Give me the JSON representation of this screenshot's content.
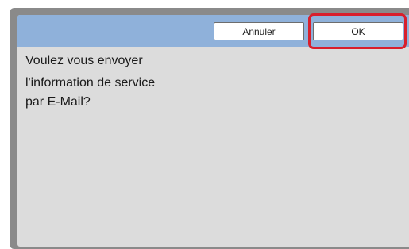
{
  "dialog": {
    "buttons": {
      "cancel_label": "Annuler",
      "ok_label": "OK"
    },
    "message_lines": [
      "Voulez vous envoyer",
      "l'information de service",
      "par E-Mail?"
    ]
  },
  "colors": {
    "header": "#8fb1da",
    "screen": "#dcdcdc",
    "highlight": "#d81f2c"
  }
}
